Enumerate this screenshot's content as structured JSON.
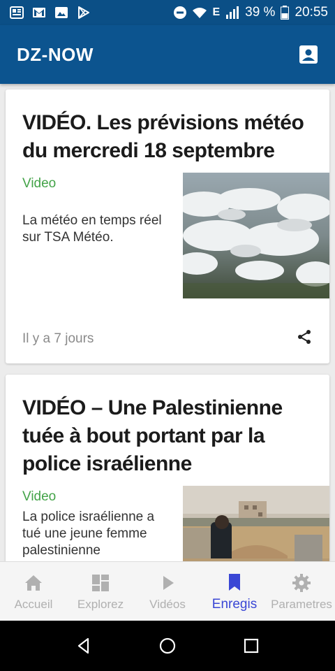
{
  "status_bar": {
    "network": "E",
    "battery_percent": "39 %",
    "time": "20:55",
    "left_icons": [
      "news-icon",
      "gmail-icon",
      "image-icon",
      "play-store-icon"
    ],
    "right_icons": [
      "dnd-icon",
      "wifi-icon",
      "signal-icon",
      "battery-icon"
    ]
  },
  "app_bar": {
    "title": "DZ-NOW",
    "action_icon": "account-box-icon"
  },
  "articles": [
    {
      "title": "VIDÉO. Les prévisions météo du mercredi 18 septembre",
      "tag": "Video",
      "summary": "La météo en temps réel sur TSA Météo.",
      "date": "Il y a 7 jours",
      "thumbnail": "aerial-clouds-image"
    },
    {
      "title": "VIDÉO – Une Palestinienne tuée à bout portant par la police israélienne",
      "tag": "Video",
      "summary": "La police israélienne a tué une jeune femme palestinienne",
      "thumbnail": "checkpoint-scene-image"
    }
  ],
  "bottom_nav": {
    "items": [
      {
        "label": "Accueil",
        "icon": "home-icon"
      },
      {
        "label": "Explorez",
        "icon": "dashboard-icon"
      },
      {
        "label": "Vidéos",
        "icon": "play-icon"
      },
      {
        "label": "Enregis",
        "icon": "bookmark-icon"
      },
      {
        "label": "Parametres",
        "icon": "gear-icon"
      }
    ],
    "active_index": 3
  },
  "colors": {
    "primary": "#0c548f",
    "status_bar": "#0b4f86",
    "accent_active": "#3a47d5",
    "tag_green": "#43a348"
  }
}
